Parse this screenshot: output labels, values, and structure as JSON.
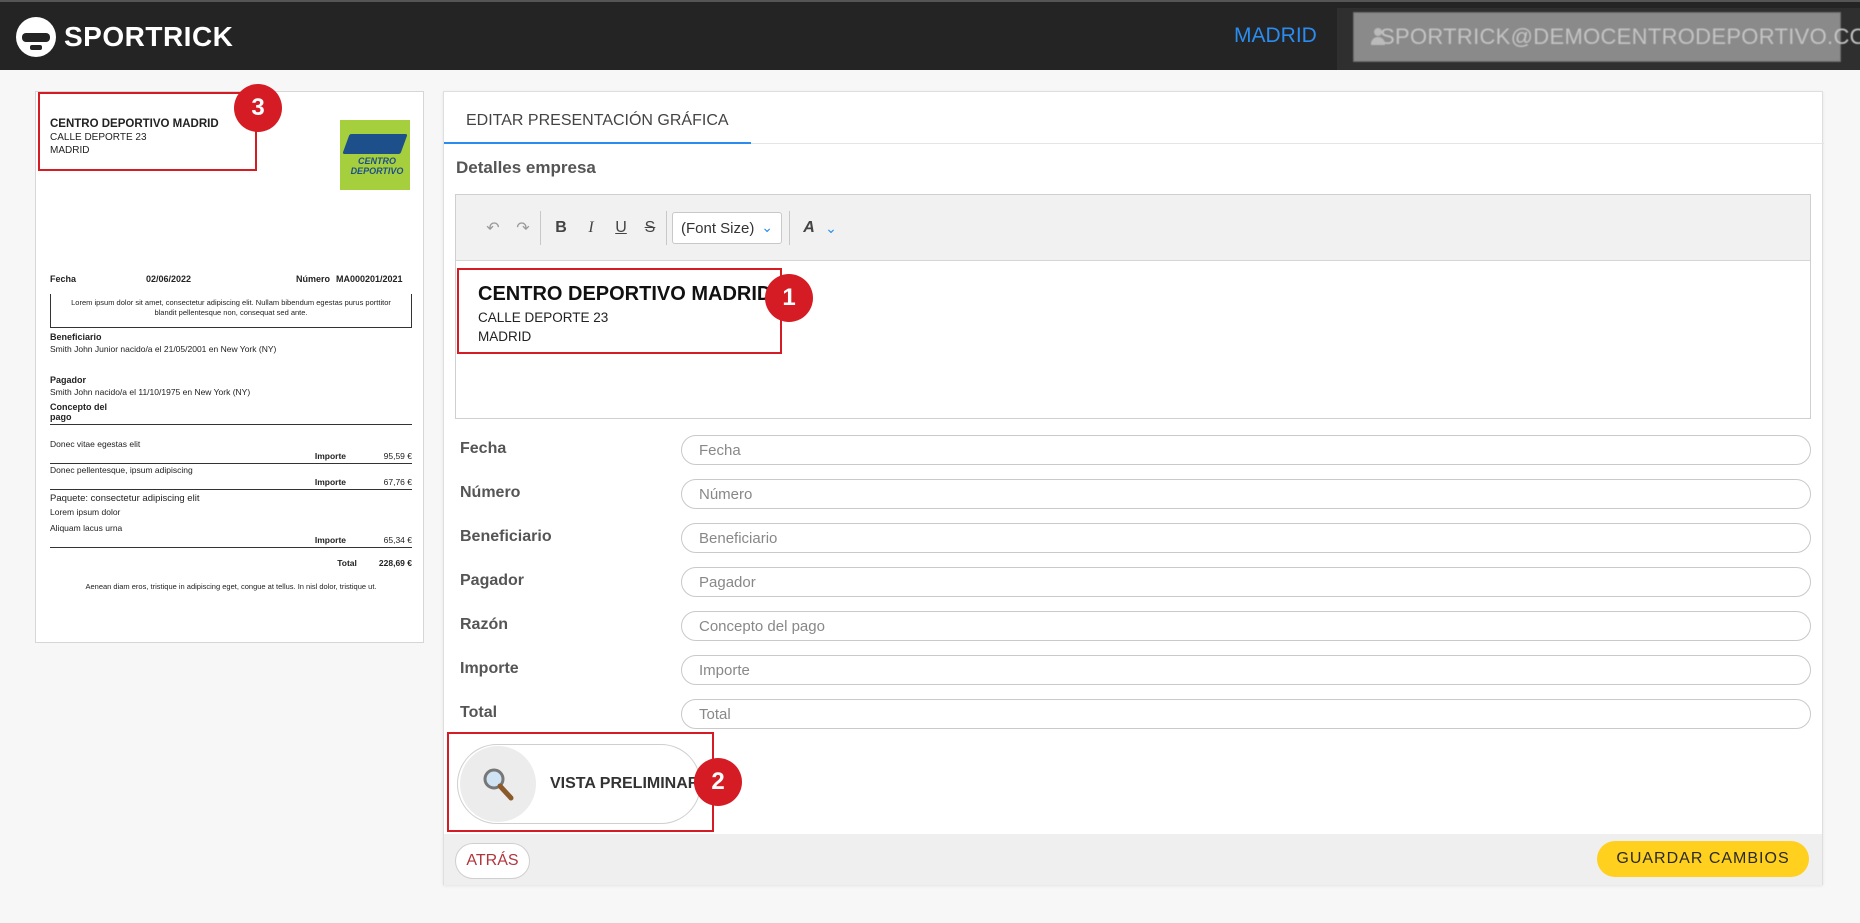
{
  "topbar": {
    "brand": "SPORTRICK",
    "city": "MADRID",
    "user_email": "SPORTRICK@DEMOCENTRODEPORTIVO.COM"
  },
  "document_preview": {
    "company_name": "CENTRO DEPORTIVO  MADRID",
    "company_address": "CALLE DEPORTE 23",
    "company_city": "MADRID",
    "logo_text": "CENTRO DEPORTIVO",
    "fecha_label": "Fecha",
    "fecha_value": "02/06/2022",
    "numero_label": "Número",
    "numero_value": "MA000201/2021",
    "lorem_intro": "Lorem ipsum dolor sit amet, consectetur adipiscing elit. Nullam bibendum egestas purus porttitor blandit pellentesque non, consequat sed ante.",
    "beneficiario_label": "Beneficiario",
    "beneficiario_value": "Smith John Junior nacido/a el 21/05/2001 en New York (NY)",
    "pagador_label": "Pagador",
    "pagador_value": "Smith John nacido/a el 11/10/1975 en New York (NY)",
    "concepto_label_1": "Concepto del",
    "concepto_label_2": "pago",
    "items": [
      {
        "lines": [
          "Donec vitae egestas elit"
        ],
        "importe_label": "Importe",
        "importe": "95,59 €"
      },
      {
        "lines": [
          "Donec pellentesque, ipsum adipiscing"
        ],
        "importe_label": "Importe",
        "importe": "67,76 €"
      },
      {
        "lines": [
          "Paquete: consectetur adipiscing elit",
          "Lorem ipsum dolor",
          "Aliquam lacus urna"
        ],
        "importe_label": "Importe",
        "importe": "65,34 €"
      }
    ],
    "total_label": "Total",
    "total_value": "228,69 €",
    "footer": "Aenean diam eros, tristique in adipiscing eget, congue at tellus. In nisl dolor, tristique ut."
  },
  "callouts": {
    "one": "1",
    "two": "2",
    "three": "3"
  },
  "panel": {
    "tab_label": "EDITAR PRESENTACIÓN GRÁFICA",
    "section_label": "Detalles empresa",
    "toolbar": {
      "undo_icon": "undo-icon",
      "redo_icon": "redo-icon",
      "bold": "B",
      "italic": "I",
      "underline": "U",
      "strike": "S",
      "font_size": "(Font Size)",
      "font_color_icon": "text-color-icon"
    },
    "editor": {
      "heading": "CENTRO DEPORTIVO MADRID",
      "line1": "CALLE DEPORTE 23",
      "line2": "MADRID"
    },
    "fields": [
      {
        "label": "Fecha",
        "placeholder": "Fecha"
      },
      {
        "label": "Número",
        "placeholder": "Número"
      },
      {
        "label": "Beneficiario",
        "placeholder": "Beneficiario"
      },
      {
        "label": "Pagador",
        "placeholder": "Pagador"
      },
      {
        "label": "Razón",
        "placeholder": "Concepto del pago"
      },
      {
        "label": "Importe",
        "placeholder": "Importe"
      },
      {
        "label": "Total",
        "placeholder": "Total"
      }
    ],
    "preview_button": "VISTA PRELIMINAR",
    "back_button": "ATRÁS",
    "save_button": "GUARDAR CAMBIOS"
  },
  "colors": {
    "accent_blue": "#2a8cf0",
    "callout_red": "#d51c24",
    "save_yellow": "#ffd01e",
    "topbar_bg": "#242424"
  }
}
